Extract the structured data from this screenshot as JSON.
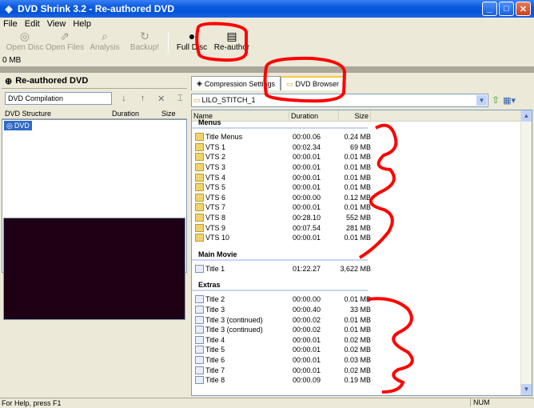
{
  "window": {
    "title": "DVD Shrink 3.2 - Re-authored DVD"
  },
  "menu": [
    "File",
    "Edit",
    "View",
    "Help"
  ],
  "toolbar": [
    {
      "label": "Open Disc",
      "icon": "disc-icon"
    },
    {
      "label": "Open Files",
      "icon": "open-files-icon"
    },
    {
      "label": "Analysis",
      "icon": "analysis-icon"
    },
    {
      "label": "Backup!",
      "icon": "backup-icon"
    },
    {
      "label": "Full Disc",
      "icon": "full-disc-icon"
    },
    {
      "label": "Re-author",
      "icon": "re-author-icon"
    }
  ],
  "size_indicator": "0 MB",
  "left": {
    "header": "Re-authored DVD",
    "compilation_name": "DVD Compilation",
    "columns": [
      "DVD Structure",
      "Duration",
      "Size"
    ],
    "tree_root": "DVD"
  },
  "tabs": [
    "Compression Settings",
    "DVD Browser"
  ],
  "browser": {
    "path": "LILO_STITCH_1",
    "columns": [
      "Name",
      "Duration",
      "Size"
    ],
    "sections": [
      {
        "title": "Menus",
        "rows": [
          {
            "name": "Title Menus",
            "duration": "00:00.06",
            "size": "0.24 MB",
            "icon": "folder"
          },
          {
            "name": "VTS 1",
            "duration": "00:02.34",
            "size": "69 MB",
            "icon": "folder"
          },
          {
            "name": "VTS 2",
            "duration": "00:00.01",
            "size": "0.01 MB",
            "icon": "folder"
          },
          {
            "name": "VTS 3",
            "duration": "00:00.01",
            "size": "0.01 MB",
            "icon": "folder"
          },
          {
            "name": "VTS 4",
            "duration": "00:00.01",
            "size": "0.01 MB",
            "icon": "folder"
          },
          {
            "name": "VTS 5",
            "duration": "00:00.01",
            "size": "0.01 MB",
            "icon": "folder"
          },
          {
            "name": "VTS 6",
            "duration": "00:00.00",
            "size": "0.12 MB",
            "icon": "folder"
          },
          {
            "name": "VTS 7",
            "duration": "00:00.01",
            "size": "0.01 MB",
            "icon": "folder"
          },
          {
            "name": "VTS 8",
            "duration": "00:28.10",
            "size": "552 MB",
            "icon": "folder"
          },
          {
            "name": "VTS 9",
            "duration": "00:07.54",
            "size": "281 MB",
            "icon": "folder"
          },
          {
            "name": "VTS 10",
            "duration": "00:00.01",
            "size": "0.01 MB",
            "icon": "folder"
          }
        ]
      },
      {
        "title": "Main Movie",
        "rows": [
          {
            "name": "Title 1",
            "duration": "01:22.27",
            "size": "3,622 MB",
            "icon": "doc"
          }
        ]
      },
      {
        "title": "Extras",
        "rows": [
          {
            "name": "Title 2",
            "duration": "00:00.00",
            "size": "0.01 MB",
            "icon": "doc"
          },
          {
            "name": "Title 3",
            "duration": "00:00.40",
            "size": "33 MB",
            "icon": "doc"
          },
          {
            "name": "Title 3 (continued)",
            "duration": "00:00.02",
            "size": "0.01 MB",
            "icon": "doc"
          },
          {
            "name": "Title 3 (continued)",
            "duration": "00:00.02",
            "size": "0.01 MB",
            "icon": "doc"
          },
          {
            "name": "Title 4",
            "duration": "00:00.01",
            "size": "0.02 MB",
            "icon": "doc"
          },
          {
            "name": "Title 5",
            "duration": "00:00.01",
            "size": "0.02 MB",
            "icon": "doc"
          },
          {
            "name": "Title 6",
            "duration": "00:00.01",
            "size": "0.03 MB",
            "icon": "doc"
          },
          {
            "name": "Title 7",
            "duration": "00:00.01",
            "size": "0.02 MB",
            "icon": "doc"
          },
          {
            "name": "Title 8",
            "duration": "00:00.09",
            "size": "0.19 MB",
            "icon": "doc"
          }
        ]
      }
    ]
  },
  "status": {
    "help": "For Help, press F1",
    "num": "NUM"
  },
  "colors": {
    "annotation": "#ff0000",
    "title_bar": "#0a5ae0",
    "video_bg": "#1e0014"
  }
}
